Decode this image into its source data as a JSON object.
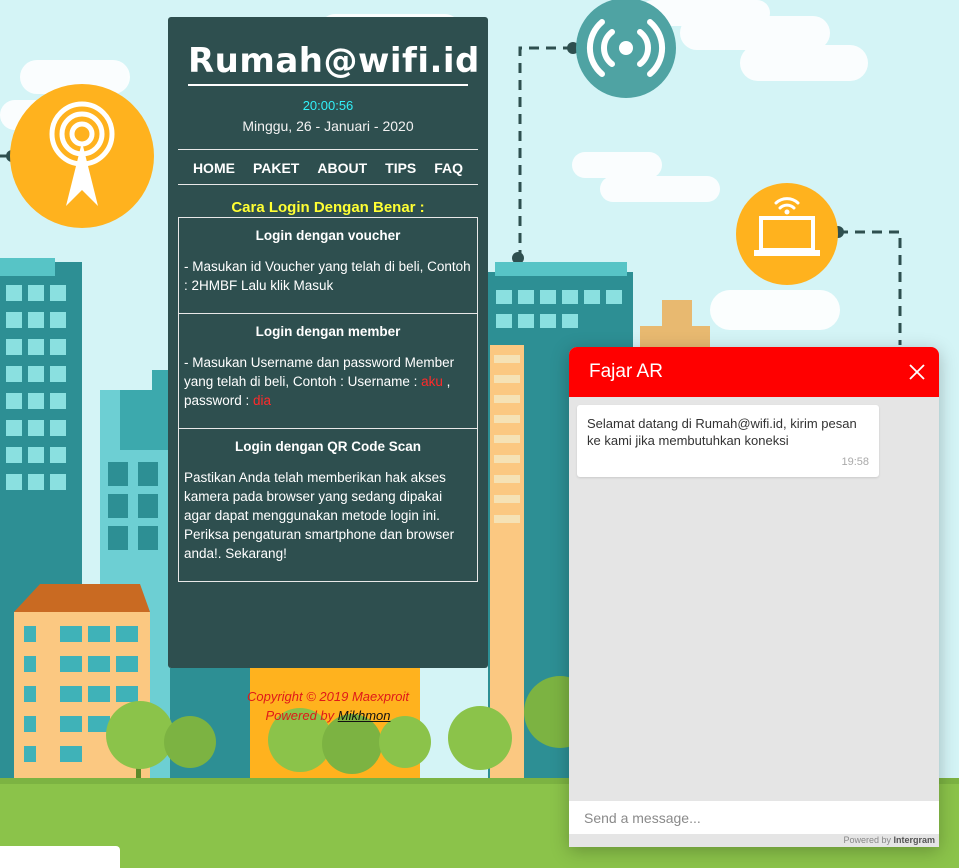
{
  "site": {
    "brand": "Rumah@wifi.id"
  },
  "datetime": {
    "time": "20:00:56",
    "date": "Minggu, 26 - Januari - 2020"
  },
  "nav": {
    "home": "HOME",
    "paket": "PAKET",
    "about": "ABOUT",
    "tips": "TIPS",
    "faq": "FAQ"
  },
  "login": {
    "heading": "Cara Login Dengan Benar :",
    "voucher": {
      "title": "Login dengan voucher",
      "text": "- Masukan id Voucher yang telah di beli, Contoh : 2HMBF Lalu klik Masuk"
    },
    "member": {
      "title": "Login dengan member",
      "text_before": "- Masukan Username dan password Member yang telah di beli, Contoh : Username : ",
      "username": "aku",
      "text_middle": " , password : ",
      "password": "dia"
    },
    "qr": {
      "title": "Login dengan QR Code Scan",
      "text": "Pastikan Anda telah memberikan hak akses kamera pada browser yang sedang dipakai agar dapat menggunakan metode login ini. Periksa pengaturan smartphone dan browser anda!. Sekarang!"
    }
  },
  "footer": {
    "copyright": "Copyright © 2019 Maexproit",
    "powered_prefix": "Powered by ",
    "powered_link": "Mikhmon"
  },
  "chat": {
    "title": "Fajar AR",
    "message": "Selamat datang di Rumah@wifi.id, kirim pesan ke kami jika membutuhkan koneksi",
    "time": "19:58",
    "placeholder": "Send a message...",
    "powered_prefix": "Powered by ",
    "powered_brand": "Intergram"
  },
  "colors": {
    "card": "#2e4f4f",
    "clock": "#31f0f8",
    "heading": "#ffff33",
    "chat_header": "#ff0000",
    "sky": "#d4f4f6",
    "grass": "#8bc34a",
    "accent_orange": "#ffb21e"
  },
  "icons": [
    "antenna-icon",
    "wifi-signal-icon",
    "laptop-wifi-icon",
    "close-icon"
  ]
}
